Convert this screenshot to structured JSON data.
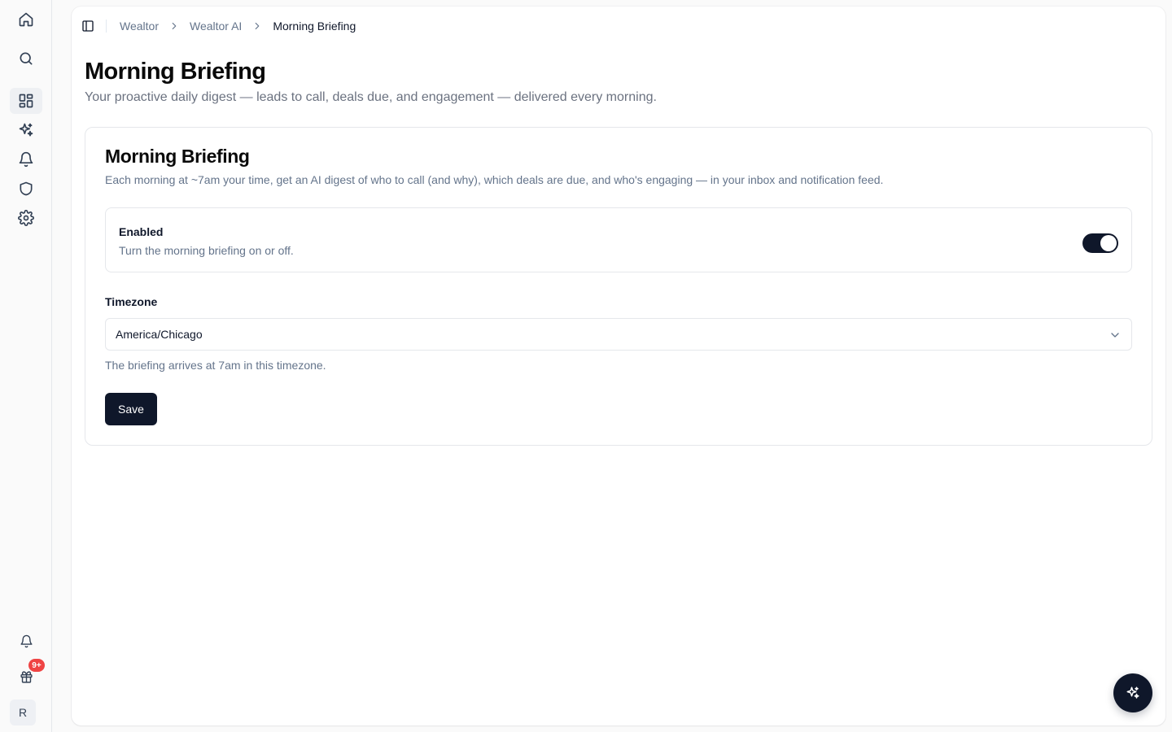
{
  "rail": {
    "notification_badge": "9+",
    "avatar_initial": "R",
    "icons": [
      "home-icon",
      "search-icon",
      "dashboard-icon",
      "sparkles-icon",
      "bell-icon",
      "shield-icon",
      "gear-icon",
      "bell-icon",
      "gift-icon"
    ]
  },
  "breadcrumb": {
    "items": [
      "Wealtor",
      "Wealtor AI"
    ],
    "current": "Morning Briefing"
  },
  "page": {
    "title": "Morning Briefing",
    "subtitle": "Your proactive daily digest — leads to call, deals due, and engagement — delivered every morning."
  },
  "card": {
    "title": "Morning Briefing",
    "description": "Each morning at ~7am your time, get an AI digest of who to call (and why), which deals are due, and who's engaging — in your inbox and notification feed.",
    "enabled": {
      "label": "Enabled",
      "help": "Turn the morning briefing on or off.",
      "value": true
    },
    "timezone": {
      "label": "Timezone",
      "value": "America/Chicago",
      "help": "The briefing arrives at 7am in this timezone."
    },
    "save_label": "Save"
  },
  "colors": {
    "primary": "#0f172a",
    "badge": "#ef4444",
    "muted_text": "#64748b",
    "border": "#e5e7eb"
  }
}
